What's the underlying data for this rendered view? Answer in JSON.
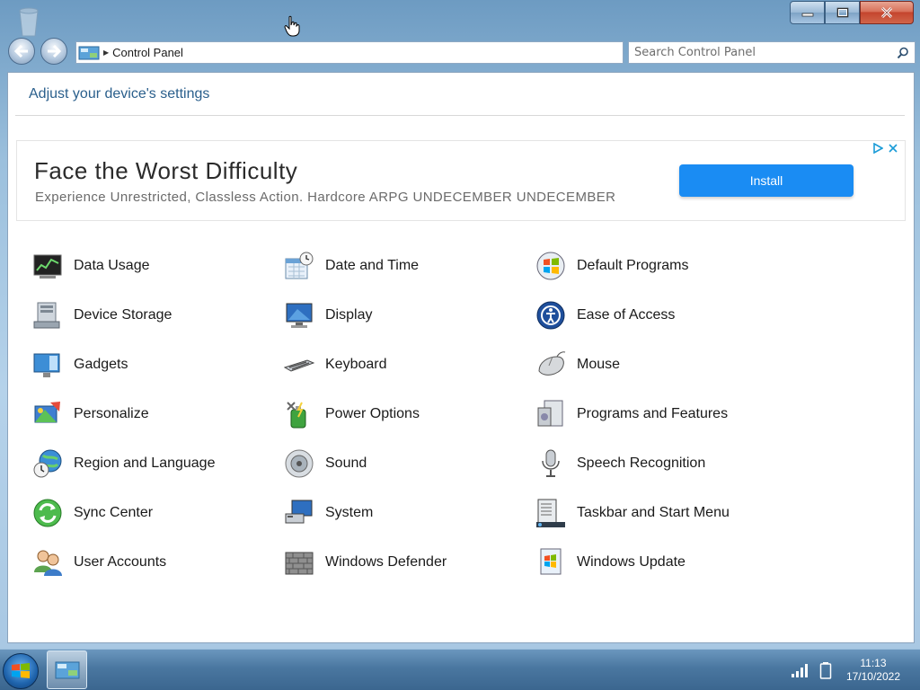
{
  "window": {
    "address": {
      "path": "Control Panel"
    },
    "search": {
      "placeholder": "Search Control Panel"
    }
  },
  "content": {
    "heading": "Adjust your device's settings",
    "ad": {
      "title": "Face the Worst Difficulty",
      "subtitle": "Experience Unrestricted, Classless Action. Hardcore ARPG UNDECEMBER UNDECEMBER",
      "button": "Install"
    },
    "items": [
      {
        "label": "Data Usage",
        "icon": "data-usage-icon"
      },
      {
        "label": "Date and Time",
        "icon": "calendar-clock-icon"
      },
      {
        "label": "Default Programs",
        "icon": "windows-globe-icon"
      },
      {
        "label": "Device Storage",
        "icon": "drive-icon"
      },
      {
        "label": "Display",
        "icon": "monitor-icon"
      },
      {
        "label": "Ease of Access",
        "icon": "ease-access-icon"
      },
      {
        "label": "Gadgets",
        "icon": "gadgets-icon"
      },
      {
        "label": "Keyboard",
        "icon": "keyboard-icon"
      },
      {
        "label": "Mouse",
        "icon": "mouse-icon"
      },
      {
        "label": "Personalize",
        "icon": "personalize-icon"
      },
      {
        "label": "Power Options",
        "icon": "power-icon"
      },
      {
        "label": "Programs and Features",
        "icon": "programs-icon"
      },
      {
        "label": "Region and Language",
        "icon": "globe-clock-icon"
      },
      {
        "label": "Sound",
        "icon": "speaker-icon"
      },
      {
        "label": "Speech Recognition",
        "icon": "microphone-icon"
      },
      {
        "label": "Sync Center",
        "icon": "sync-icon"
      },
      {
        "label": "System",
        "icon": "system-icon"
      },
      {
        "label": "Taskbar and Start Menu",
        "icon": "taskbar-icon"
      },
      {
        "label": "User Accounts",
        "icon": "users-icon"
      },
      {
        "label": "Windows Defender",
        "icon": "defender-wall-icon"
      },
      {
        "label": "Windows Update",
        "icon": "update-icon"
      }
    ]
  },
  "taskbar": {
    "time": "11:13",
    "date": "17/10/2022"
  },
  "colors": {
    "accent": "#1a8cf3",
    "heading": "#2a5f8c"
  }
}
